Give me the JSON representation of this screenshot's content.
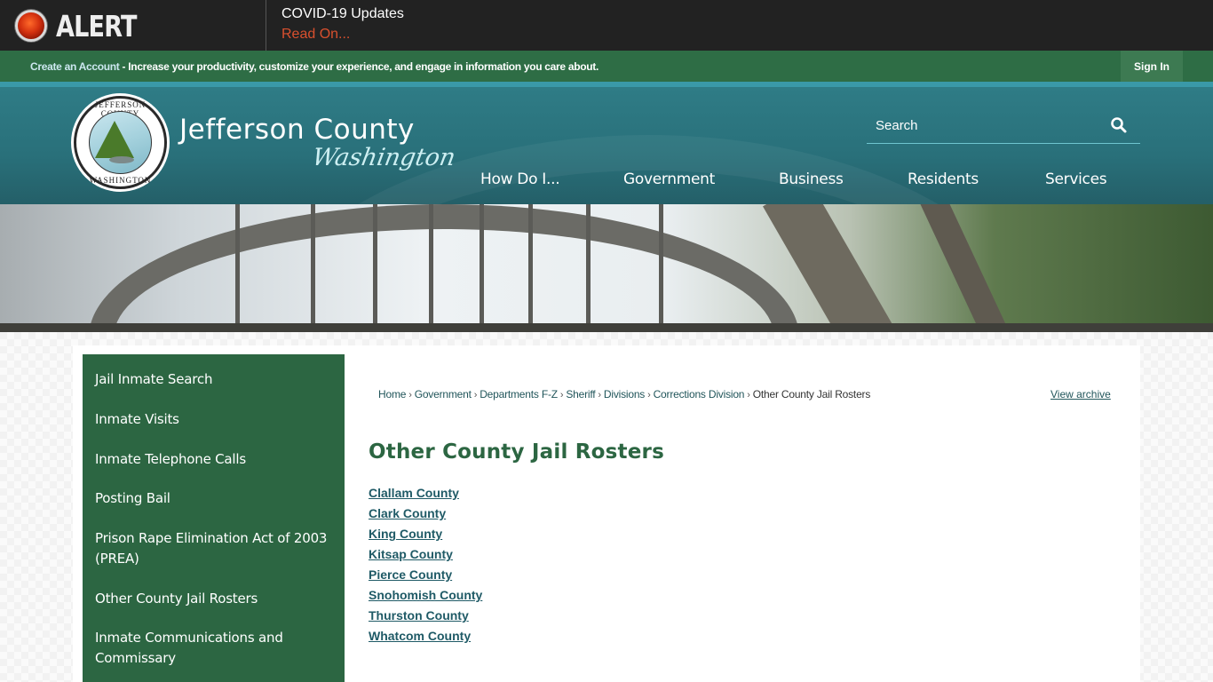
{
  "alert": {
    "label": "ALERT",
    "title": "COVID-19 Updates",
    "link": "Read On..."
  },
  "account_bar": {
    "create_link": "Create an Account",
    "message": " - Increase your productivity, customize your experience, and engage in information you care about.",
    "sign_in": "Sign In"
  },
  "header": {
    "logo_top": "JEFFERSON COUNTY",
    "logo_bottom": "WASHINGTON",
    "site_title": "Jefferson County",
    "site_subtitle": "Washington",
    "search_placeholder": "Search",
    "search_icon": "search-icon",
    "nav": [
      {
        "label": "How Do I..."
      },
      {
        "label": "Government"
      },
      {
        "label": "Business"
      },
      {
        "label": "Residents"
      },
      {
        "label": "Services"
      }
    ]
  },
  "sidebar": {
    "items": [
      {
        "label": "Jail Inmate Search"
      },
      {
        "label": "Inmate Visits"
      },
      {
        "label": "Inmate Telephone Calls"
      },
      {
        "label": "Posting Bail"
      },
      {
        "label": "Prison Rape Elimination Act of 2003 (PREA)"
      },
      {
        "label": "Other County Jail Rosters"
      },
      {
        "label": "Inmate Communications and Commissary"
      }
    ]
  },
  "breadcrumb": {
    "items": [
      {
        "label": "Home"
      },
      {
        "label": "Government"
      },
      {
        "label": "Departments F-Z"
      },
      {
        "label": "Sheriff"
      },
      {
        "label": "Divisions"
      },
      {
        "label": "Corrections Division"
      }
    ],
    "current": "Other County Jail Rosters",
    "separator": "›"
  },
  "main": {
    "view_archive": "View archive",
    "title": "Other County Jail Rosters",
    "counties": [
      {
        "label": "Clallam County"
      },
      {
        "label": "Clark County"
      },
      {
        "label": "King County"
      },
      {
        "label": "Kitsap County"
      },
      {
        "label": "Pierce County"
      },
      {
        "label": "Snohomish County"
      },
      {
        "label": "Thurston County"
      },
      {
        "label": "Whatcom County"
      }
    ]
  },
  "colors": {
    "alert_bg": "#222222",
    "alert_link": "#d9502e",
    "account_bar": "#2e6d45",
    "header_teal": "#29707a",
    "sidebar_green": "#2c6642",
    "title_green": "#2c6642",
    "link_teal": "#1f5a66"
  }
}
